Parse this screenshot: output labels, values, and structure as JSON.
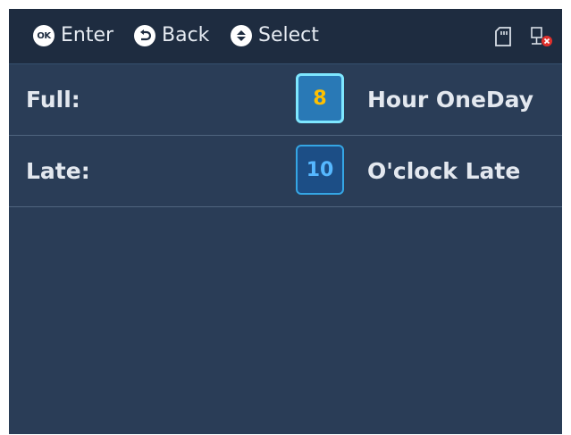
{
  "colors": {
    "panel_bg": "#2a3d57",
    "topbar_bg": "#1e2c40",
    "text": "#e3e8ef",
    "active_value": "#ffc000",
    "inactive_value": "#56b8ff",
    "active_border": "#7ee7ff",
    "inactive_border": "#35a6e4"
  },
  "topbar": {
    "hints": [
      {
        "icon": "ok-icon",
        "icon_text": "OK",
        "label": "Enter"
      },
      {
        "icon": "back-icon",
        "label": "Back"
      },
      {
        "icon": "up-down-icon",
        "label": "Select"
      }
    ],
    "status_icons": [
      "sd-card-icon",
      "network-disconnected-icon"
    ]
  },
  "rows": [
    {
      "label": "Full:",
      "value": "8",
      "suffix": "Hour OneDay",
      "selected": true
    },
    {
      "label": "Late:",
      "value": "10",
      "suffix": "O'clock Late",
      "selected": false
    }
  ]
}
